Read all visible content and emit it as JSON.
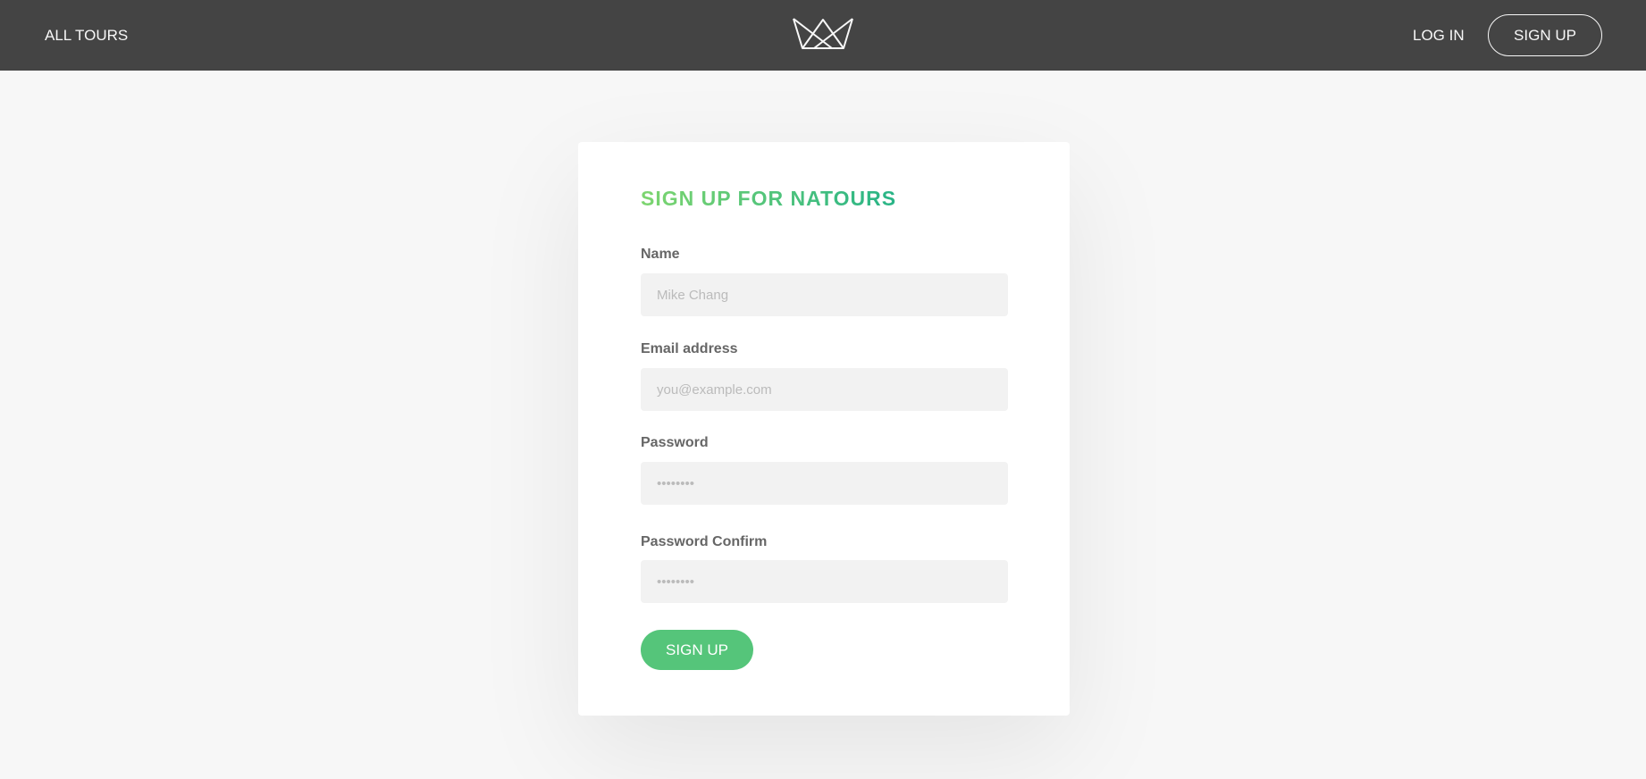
{
  "header": {
    "nav_all_tours": "ALL TOURS",
    "logo_icon": "crown-logo-icon",
    "nav_login": "LOG IN",
    "nav_signup": "SIGN UP"
  },
  "form": {
    "title": "SIGN UP FOR NATOURS",
    "fields": [
      {
        "label": "Name",
        "placeholder": "Mike Chang",
        "type": "text",
        "value": ""
      },
      {
        "label": "Email address",
        "placeholder": "you@example.com",
        "type": "email",
        "value": ""
      },
      {
        "label": "Password",
        "placeholder": "••••••••",
        "type": "password",
        "value": ""
      },
      {
        "label": "Password Confirm",
        "placeholder": "••••••••",
        "type": "password",
        "value": ""
      }
    ],
    "submit_label": "SIGN UP"
  },
  "colors": {
    "header_bg": "#444444",
    "page_bg": "#f7f7f7",
    "accent_green": "#55c57a",
    "title_gradient_start": "#7dd56f",
    "title_gradient_end": "#28b487"
  }
}
